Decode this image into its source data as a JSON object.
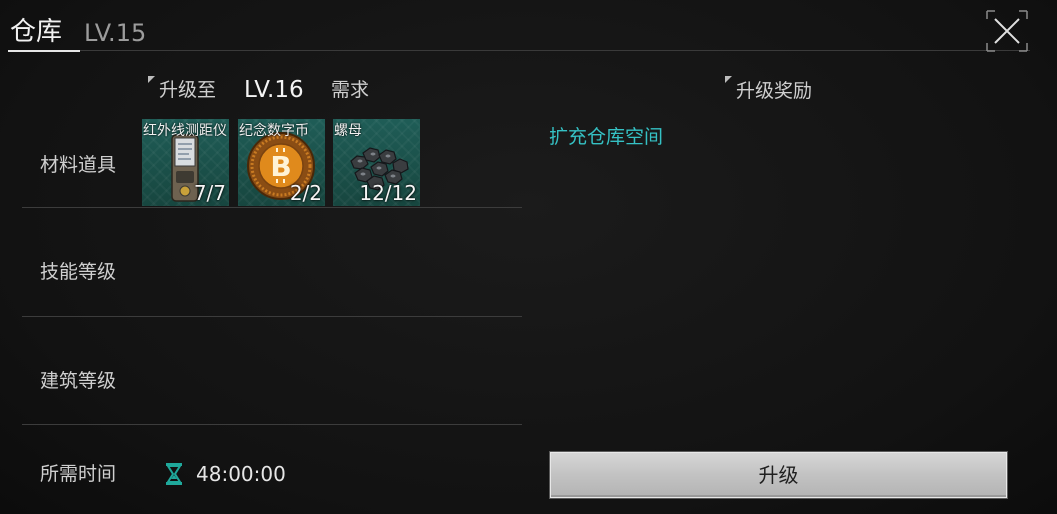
{
  "header": {
    "title": "仓库",
    "level": "LV.15"
  },
  "requirements": {
    "upgrade_to_label": "升级至",
    "target_level": "LV.16",
    "need_label": "需求"
  },
  "rewards": {
    "header": "升级奖励",
    "items": [
      "扩充仓库空间"
    ]
  },
  "rows": {
    "materials": "材料道具",
    "skill_level": "技能等级",
    "building_level": "建筑等级",
    "time_required": "所需时间"
  },
  "materials": [
    {
      "name": "红外线测距仪",
      "count": "7/7",
      "icon": "rangefinder-icon"
    },
    {
      "name": "纪念数字币",
      "count": "2/2",
      "icon": "bitcoin-icon"
    },
    {
      "name": "螺母",
      "count": "12/12",
      "icon": "nuts-icon"
    }
  ],
  "time": {
    "value": "48:00:00",
    "icon": "hourglass-icon"
  },
  "actions": {
    "upgrade_label": "升级",
    "close_icon": "close-icon"
  },
  "colors": {
    "accent_teal": "#35c1c4",
    "tile_green": "#1f5d57",
    "button_gray": "#c8c8c8"
  }
}
